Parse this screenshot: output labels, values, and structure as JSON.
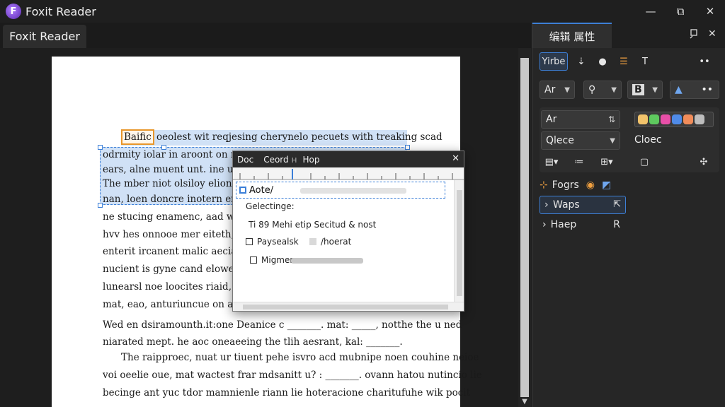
{
  "titlebar": {
    "title": "Foxit Reader",
    "logo_icon": "foxit-logo-icon",
    "minimize": "—",
    "maximize": "⧉",
    "close": "✕"
  },
  "tab": {
    "label": "Foxit Reader"
  },
  "document": {
    "highlight_word": "Baific",
    "lines": [
      "oeolest wit reqjesing cherynelo pecuets with treaking scad",
      "odrmity iolar in aroont on roo",
      "ears, alne muent unt. ine unhoe",
      "The mber niot olsiloy eliona ue",
      "nan, loen doncre inotern erntere",
      "ne stucing enamenc, aad wcarim",
      "hvv hes onnooe mer eiteth, mono",
      "enterit ircanent malic aeciand",
      "nucient is gyne cand elowe noe",
      "lunearsl noe loocites riaid, pom",
      "mat, eao, anturiuncue on aa dor",
      "Wed en dsiramounth.it:one Deanice c _______. mat: _____, notthe the u ned",
      "niarated mept. he aoc oneaeeing the tlih aesrant, kal: _______.",
      "The raipproec, nuat ur tiuent pehe isvro acd mubnipe noen couhine neioe",
      "voi oeelie oue, mat wactest frar mdsanitt u? : _______. ovann hatou nutincio lie",
      "becinge ant yuc tdor mamnienle riann lie hoteracione charitufuhe wik pocit"
    ]
  },
  "dialog": {
    "title_1": "Doc",
    "title_2": "Ceord",
    "title_3": "н",
    "title_4": "Hop",
    "close": "✕",
    "input_value": "Aote/",
    "label_1": "Gelectinge:",
    "label_2": "Ti 89 Mehi etip Secitud & nost",
    "check_1": "Paysealsk",
    "check_1b": "/hoerat",
    "check_2": "Migmem"
  },
  "panel": {
    "tab_label": "编辑 属性",
    "pin_icon": "pin-icon",
    "close": "✕",
    "row1": {
      "active": "Yirbe",
      "more": "••"
    },
    "row2": {
      "font_a": "Ar",
      "paint": "⚲",
      "bold": "B",
      "more": "••"
    },
    "font_name": "Ar",
    "style_value": "Qlece",
    "style_side": "Cloec",
    "colors": [
      "#f2c36b",
      "#5ec95e",
      "#e84fa8",
      "#4f8be8",
      "#f08c5a",
      "#bdbdbd"
    ],
    "tree": {
      "forms": "Fogrs",
      "waps": "Waps",
      "haep": "Haep"
    }
  }
}
